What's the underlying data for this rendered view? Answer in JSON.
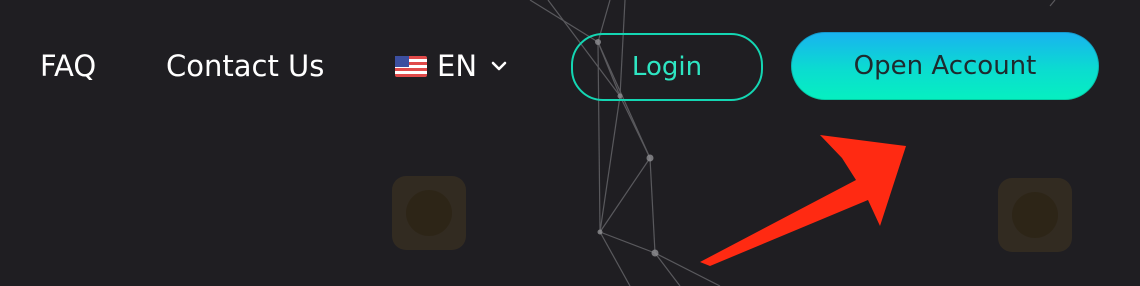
{
  "nav": {
    "faq_label": "FAQ",
    "contact_label": "Contact Us"
  },
  "language": {
    "selected": "EN",
    "flag_icon": "us-flag-icon"
  },
  "auth": {
    "login_label": "Login",
    "open_account_label": "Open Account"
  },
  "colors": {
    "background": "#1f1e22",
    "login_accent": "#14d6b3",
    "open_account_gradient_top": "#19b2f0",
    "open_account_gradient_bottom": "#06f0c0",
    "annotation_arrow": "#ff2a12"
  }
}
